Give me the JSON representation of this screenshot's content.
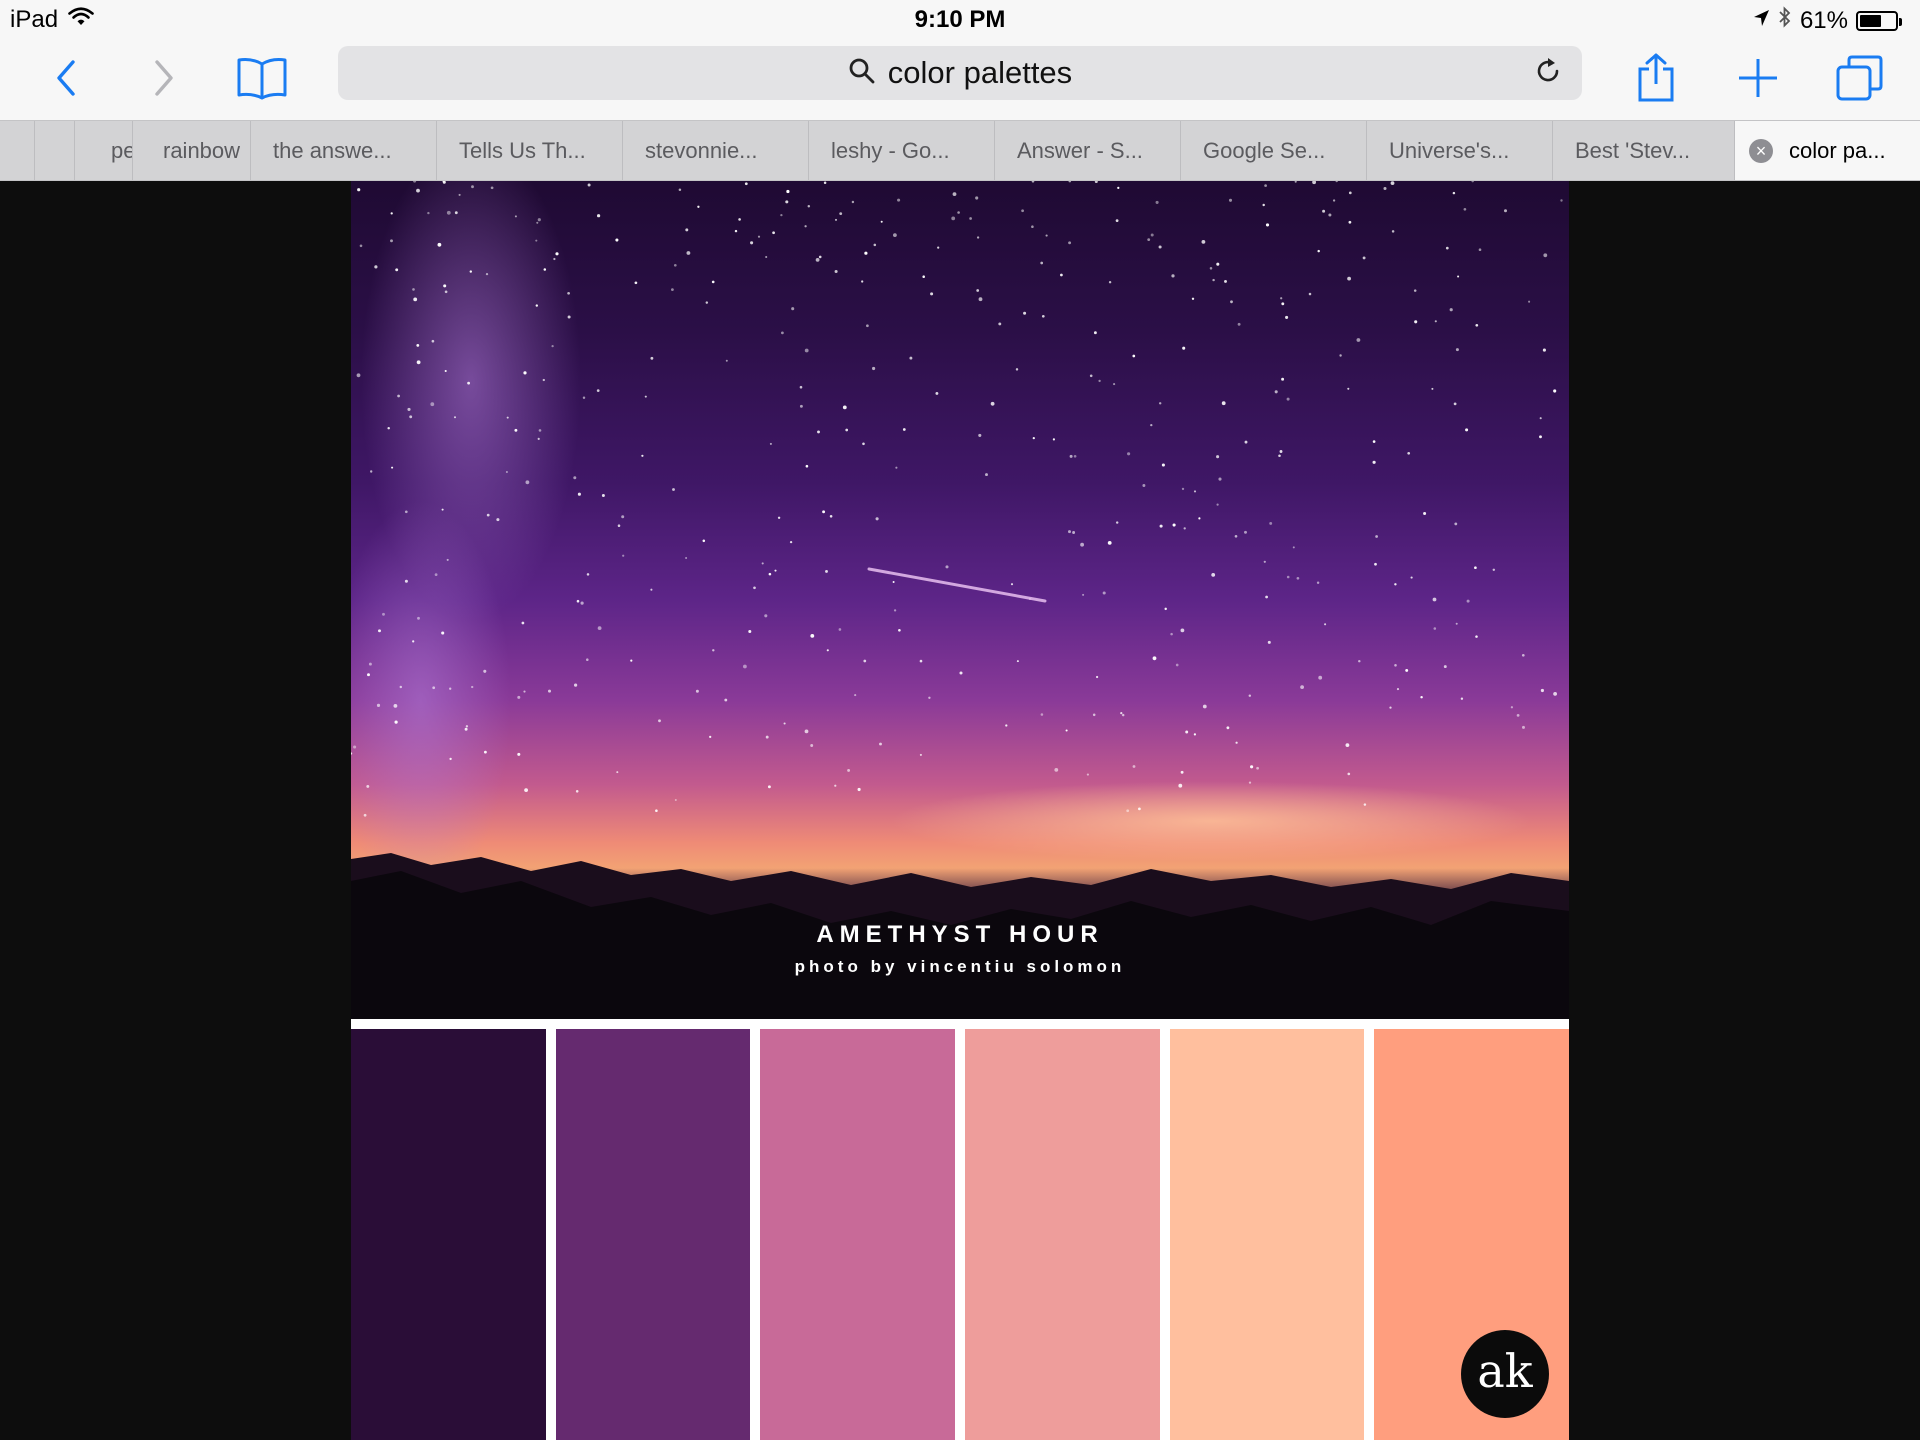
{
  "status_bar": {
    "device": "iPad",
    "time": "9:10 PM",
    "battery_percent": "61%",
    "battery_level": 0.61,
    "icons": [
      "wifi-icon",
      "location-arrow-icon",
      "bluetooth-icon",
      "battery-icon"
    ]
  },
  "toolbar": {
    "address_text": "color palettes",
    "icons": [
      "back-chevron-icon",
      "forward-chevron-icon",
      "bookmarks-book-icon",
      "search-icon",
      "reload-icon",
      "share-icon",
      "new-tab-plus-icon",
      "tabs-overview-icon"
    ]
  },
  "tabs": [
    {
      "label": ""
    },
    {
      "label": "pe"
    },
    {
      "label": "rainbow"
    },
    {
      "label": "the answe..."
    },
    {
      "label": "Tells Us Th..."
    },
    {
      "label": "stevonnie..."
    },
    {
      "label": "leshy - Go..."
    },
    {
      "label": "Answer - S..."
    },
    {
      "label": "Google Se..."
    },
    {
      "label": "Universe's..."
    },
    {
      "label": "Best 'Stev..."
    },
    {
      "label": "color pa...",
      "active": true
    }
  ],
  "page": {
    "palette_title": "AMETHYST HOUR",
    "photo_credit": "photo by vincentiu solomon",
    "logo_text": "ak",
    "swatches": [
      {
        "color": "#2a0d37"
      },
      {
        "color": "#652a6f"
      },
      {
        "color": "#c86a98"
      },
      {
        "color": "#ee9d9b"
      },
      {
        "color": "#ffbf9e"
      },
      {
        "color": "#ff9e7e"
      }
    ]
  },
  "colors": {
    "accent": "#1a7cf2",
    "chrome": "#f7f7f7",
    "tab_strip": "#d3d3d5"
  }
}
